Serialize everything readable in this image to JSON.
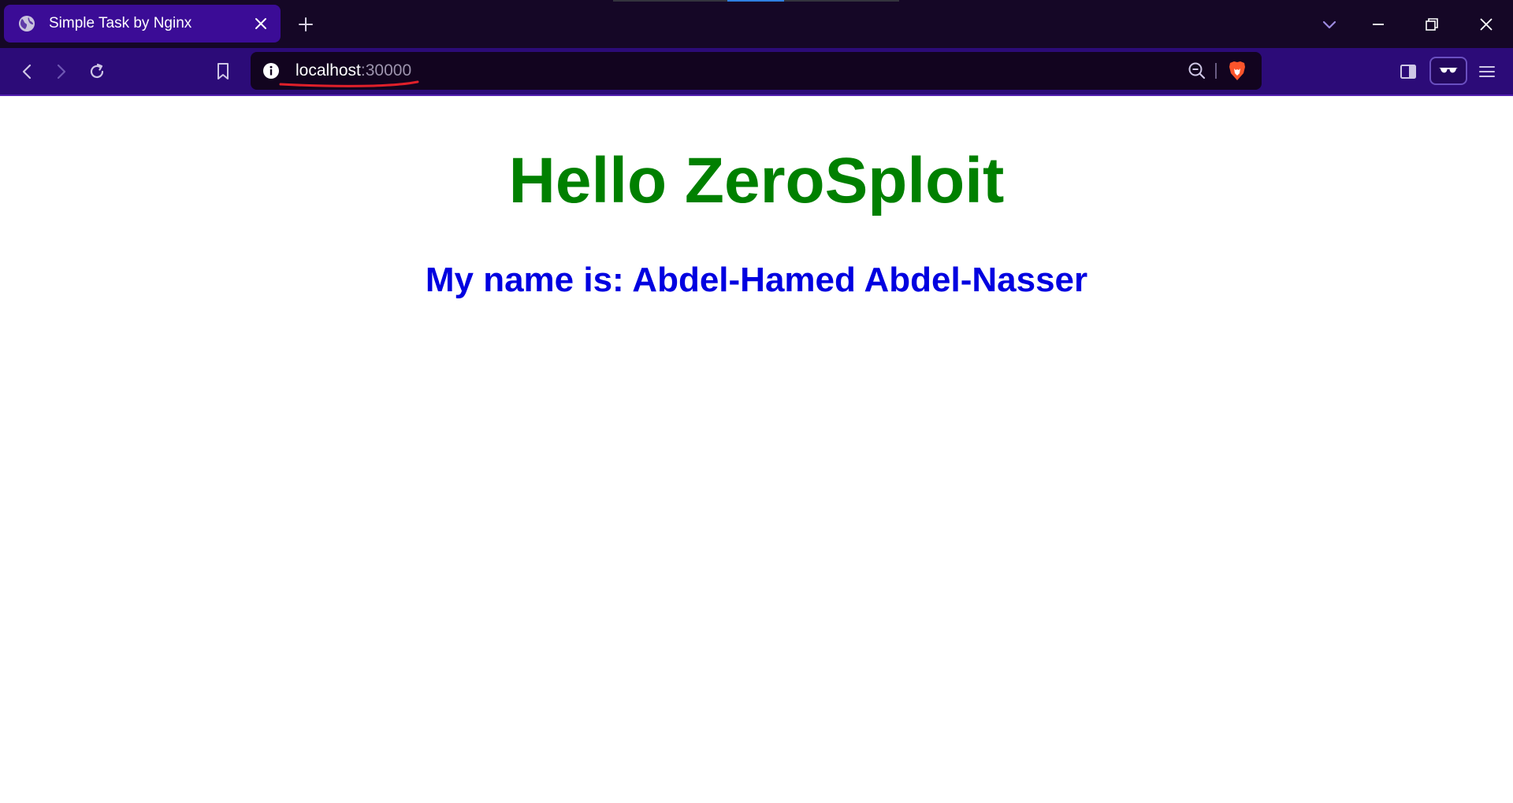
{
  "browser": {
    "tab": {
      "title": "Simple Task by Nginx"
    },
    "address_bar": {
      "host": "localhost",
      "port": ":30000"
    }
  },
  "page": {
    "heading": "Hello ZeroSploit",
    "subheading": "My name is: Abdel-Hamed Abdel-Nasser"
  },
  "icons": {
    "tab_favicon": "globe-icon",
    "tab_close": "close-icon",
    "new_tab": "plus-icon",
    "tab_list": "chevron-down-icon",
    "minimize": "minimize-icon",
    "restore": "restore-icon",
    "window_close": "close-icon",
    "back": "back-arrow-icon",
    "forward": "forward-arrow-icon",
    "reload": "reload-icon",
    "bookmark": "bookmark-icon",
    "site_info": "info-icon",
    "zoom": "zoom-out-icon",
    "brave_shields": "brave-lion-icon",
    "sidebar": "sidebar-icon",
    "reader_mode": "glasses-icon",
    "menu": "hamburger-menu-icon"
  },
  "colors": {
    "heading": "#008000",
    "subheading": "#0000e0",
    "annotation_underline": "#e0202a",
    "tab_active": "#3b0c96",
    "toolbar": "#2c0b78"
  }
}
